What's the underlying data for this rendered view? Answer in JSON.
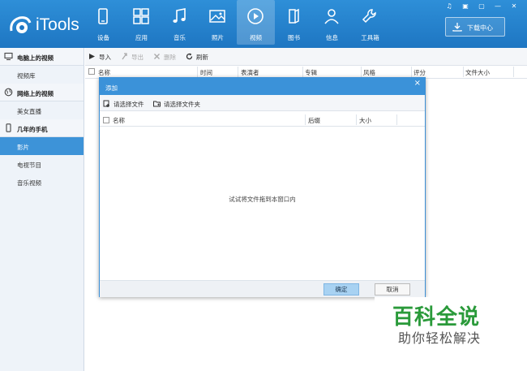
{
  "app": {
    "logo_text": "iTools"
  },
  "nav": [
    {
      "label": "设备",
      "icon": "phone-icon"
    },
    {
      "label": "应用",
      "icon": "apps-grid-icon"
    },
    {
      "label": "音乐",
      "icon": "music-note-icon"
    },
    {
      "label": "照片",
      "icon": "picture-icon"
    },
    {
      "label": "视频",
      "icon": "play-circle-icon"
    },
    {
      "label": "图书",
      "icon": "book-icon"
    },
    {
      "label": "信息",
      "icon": "person-icon"
    },
    {
      "label": "工具箱",
      "icon": "wrench-icon"
    }
  ],
  "nav_active": "视频",
  "download_center": "下载中心",
  "window_controls": [
    "♫",
    "▣",
    "▢",
    "—",
    "✕"
  ],
  "sidebar": {
    "sections": [
      {
        "title": "电脑上的视频",
        "items": [
          "视频库"
        ]
      },
      {
        "title": "网络上的视频",
        "items": [
          "美女直播"
        ]
      },
      {
        "title": "几年的手机",
        "items": [
          "影片",
          "电视节目",
          "音乐视频"
        ]
      }
    ],
    "active_item": "影片"
  },
  "toolbar": {
    "import": "导入",
    "export": "导出",
    "delete": "删除",
    "refresh": "刷新"
  },
  "columns": [
    "名称",
    "时间",
    "表演者",
    "专辑",
    "风格",
    "评分",
    "文件大小"
  ],
  "dialog": {
    "title": "添加",
    "close": "×",
    "select_file": "请选择文件",
    "select_folder": "请选择文件夹",
    "columns": [
      "名称",
      "后缀",
      "大小"
    ],
    "empty_message": "试试将文件拖到本窗口内",
    "ok": "确定",
    "cancel": "取消"
  },
  "watermark": {
    "main": "百科全说",
    "sub": "助你轻松解决"
  },
  "colors": {
    "topbar": "#1e76c2",
    "active_item": "#3d93d8",
    "watermark_green": "#2a9a3a"
  }
}
